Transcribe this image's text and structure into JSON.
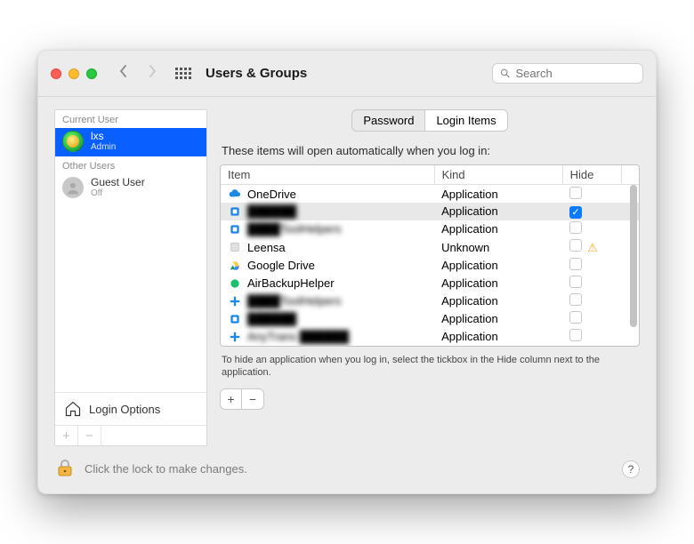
{
  "header": {
    "title": "Users & Groups",
    "search_placeholder": "Search"
  },
  "sidebar": {
    "current_label": "Current User",
    "others_label": "Other Users",
    "current": {
      "name": "lxs",
      "role": "Admin"
    },
    "others": [
      {
        "name": "Guest User",
        "role": "Off"
      }
    ],
    "login_options_label": "Login Options"
  },
  "tabs": {
    "password": "Password",
    "login_items": "Login Items"
  },
  "main": {
    "description": "These items will open automatically when you log in:",
    "columns": {
      "item": "Item",
      "kind": "Kind",
      "hide": "Hide"
    },
    "items": [
      {
        "name": "OneDrive",
        "kind": "Application",
        "hide": false,
        "warn": false,
        "blur": false,
        "icon": "cloud-blue"
      },
      {
        "name": "██████",
        "kind": "Application",
        "hide": true,
        "warn": false,
        "blur": true,
        "icon": "app-blue"
      },
      {
        "name": "████ToolHelpers",
        "kind": "Application",
        "hide": false,
        "warn": false,
        "blur": true,
        "icon": "app-blue"
      },
      {
        "name": "Leensa",
        "kind": "Unknown",
        "hide": false,
        "warn": true,
        "blur": false,
        "icon": "generic"
      },
      {
        "name": "Google Drive",
        "kind": "Application",
        "hide": false,
        "warn": false,
        "blur": false,
        "icon": "gdrive"
      },
      {
        "name": "AirBackupHelper",
        "kind": "Application",
        "hide": false,
        "warn": false,
        "blur": false,
        "icon": "air-green"
      },
      {
        "name": "████ToolHelpers",
        "kind": "Application",
        "hide": false,
        "warn": false,
        "blur": true,
        "icon": "plus-blue"
      },
      {
        "name": "██████",
        "kind": "Application",
        "hide": false,
        "warn": false,
        "blur": true,
        "icon": "app-blue"
      },
      {
        "name": "AnyTrans ██████",
        "kind": "Application",
        "hide": false,
        "warn": false,
        "blur": true,
        "icon": "plus-blue"
      }
    ],
    "hint": "To hide an application when you log in, select the tickbox in the Hide column next to the application."
  },
  "footer": {
    "lock_text": "Click the lock to make changes."
  }
}
